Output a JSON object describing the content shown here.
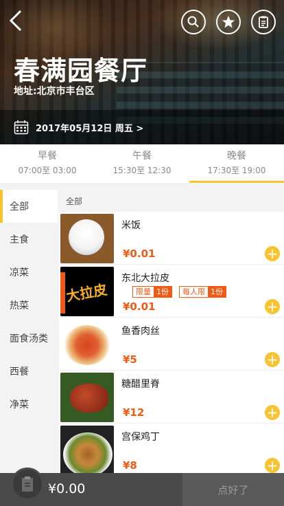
{
  "header": {
    "restaurant_name": "春满园餐厅",
    "address": "地址:北京市丰台区",
    "date_text": "2017年05月12日 周五 >"
  },
  "meal_tabs": [
    {
      "name": "早餐",
      "time": "07:00至 03:00"
    },
    {
      "name": "午餐",
      "time": "15:30至 12:30"
    },
    {
      "name": "晚餐",
      "time": "17:30至 19:00"
    }
  ],
  "sidebar": {
    "items": [
      {
        "label": "全部"
      },
      {
        "label": "主食"
      },
      {
        "label": "凉菜"
      },
      {
        "label": "热菜"
      },
      {
        "label": "面食汤类"
      },
      {
        "label": "西餐"
      },
      {
        "label": "净菜"
      }
    ]
  },
  "content": {
    "section_title": "全部",
    "dishes": [
      {
        "name": "米饭",
        "price": "¥0.01"
      },
      {
        "name": "东北大拉皮",
        "price": "¥0.01",
        "tag1_a": "限量",
        "tag1_b": "1份",
        "tag2_a": "每人限",
        "tag2_b": "1份",
        "photo_text": "大拉皮"
      },
      {
        "name": "鱼香肉丝",
        "price": "¥5"
      },
      {
        "name": "糖醋里脊",
        "price": "¥12"
      },
      {
        "name": "宫保鸡丁",
        "price": "¥8"
      }
    ]
  },
  "bottom": {
    "total": "¥0.00",
    "confirm_label": "点好了"
  },
  "colors": {
    "accent": "#f7c330",
    "price": "#f05a14",
    "bottom_bar": "#4a4a4a"
  },
  "icons": [
    "back-icon",
    "search-icon",
    "star-icon",
    "clipboard-icon",
    "calendar-icon",
    "plus-icon",
    "cart-clipboard-icon"
  ]
}
